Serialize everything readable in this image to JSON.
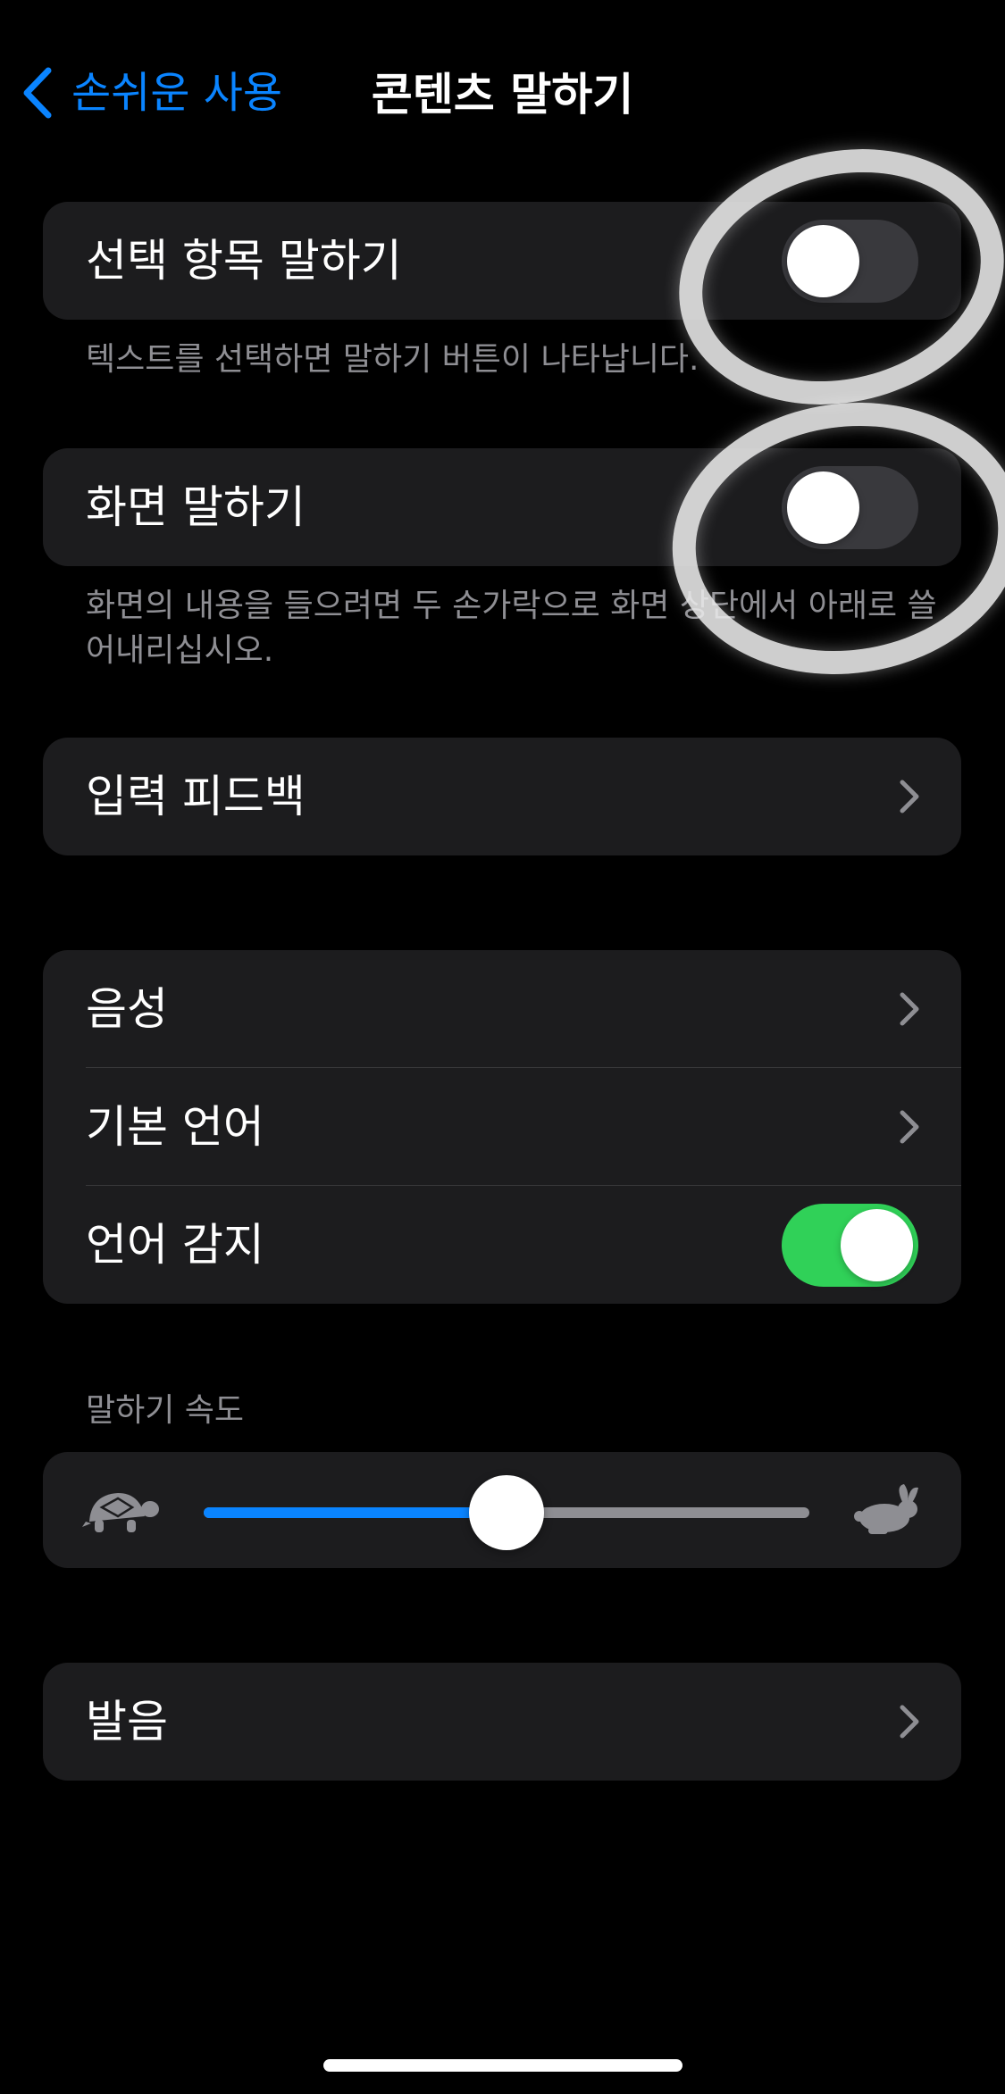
{
  "nav": {
    "back_label": "손쉬운 사용",
    "title": "콘텐츠 말하기"
  },
  "speak_selection": {
    "label": "선택 항목 말하기",
    "enabled": false,
    "footer": "텍스트를 선택하면 말하기 버튼이 나타납니다."
  },
  "speak_screen": {
    "label": "화면 말하기",
    "enabled": false,
    "footer": "화면의 내용을 들으려면 두 손가락으로 화면 상단에서 아래로 쓸어내리십시오."
  },
  "typing_feedback": {
    "label": "입력 피드백"
  },
  "voice_group": {
    "voices_label": "음성",
    "default_language_label": "기본 언어",
    "detect_languages_label": "언어 감지",
    "detect_languages_enabled": true
  },
  "speaking_rate": {
    "header": "말하기 속도",
    "value_fraction": 0.5
  },
  "pronunciations": {
    "label": "발음"
  },
  "colors": {
    "accent": "#0a84ff",
    "toggle_on": "#30d158",
    "toggle_off": "#39393d",
    "cell_bg": "#1c1c1e",
    "secondary_text": "#8e8e93"
  }
}
